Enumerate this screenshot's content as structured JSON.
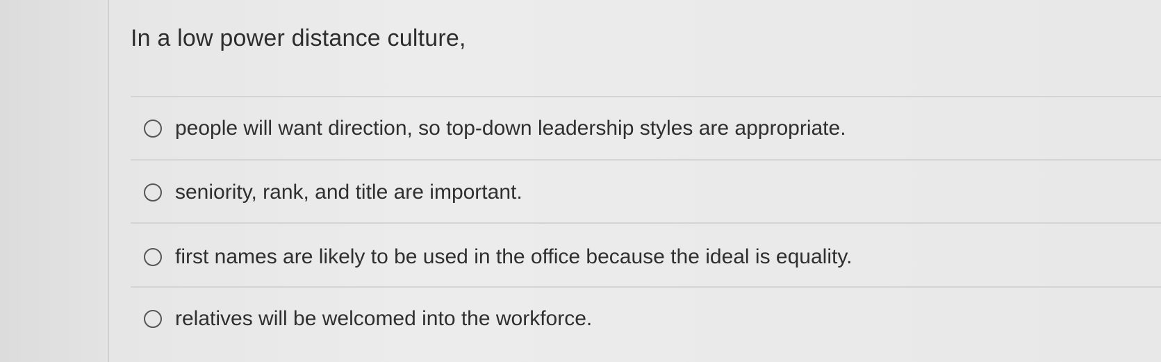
{
  "question": {
    "prompt": "In a low power distance culture,",
    "options": [
      {
        "label": "people will want direction, so top-down leadership styles are appropriate.",
        "selected": false
      },
      {
        "label": "seniority, rank, and title are important.",
        "selected": false
      },
      {
        "label": "first names are likely to be used in the office because the ideal is equality.",
        "selected": false
      },
      {
        "label": "relatives will be welcomed into the workforce.",
        "selected": false
      }
    ]
  }
}
